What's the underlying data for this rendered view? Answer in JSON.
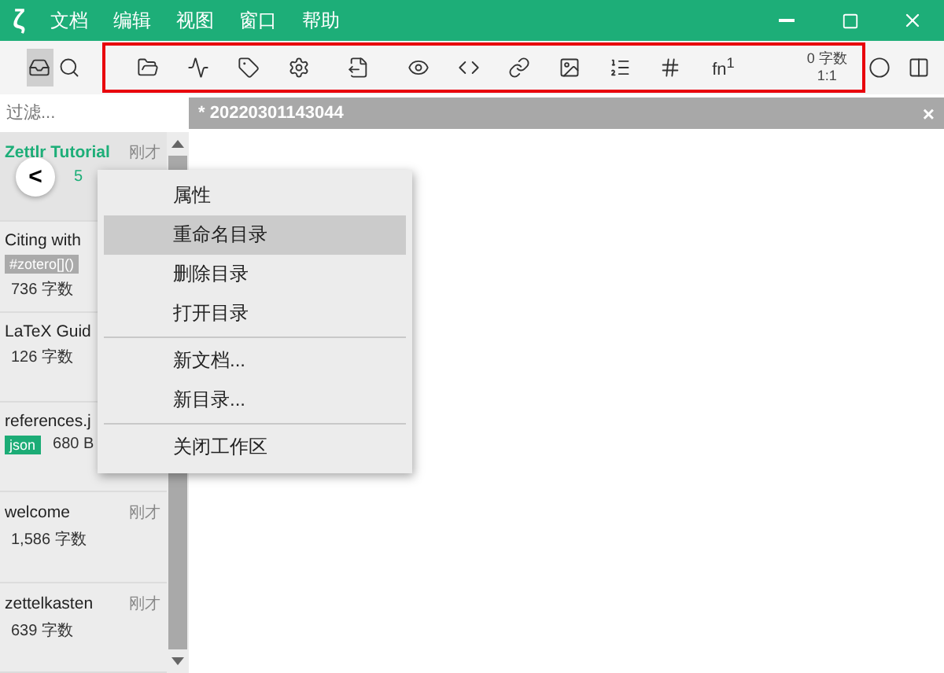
{
  "window": {
    "logo": "ζ",
    "menu": [
      "文档",
      "编辑",
      "视图",
      "窗口",
      "帮助"
    ]
  },
  "toolbar": {
    "left": [
      {
        "kind": "drawer",
        "selected": true
      },
      {
        "kind": "search",
        "selected": false
      }
    ],
    "tools": [
      {
        "kind": "folder"
      },
      {
        "kind": "chart"
      },
      {
        "kind": "tag"
      },
      {
        "kind": "settings"
      },
      {
        "kind": "export"
      },
      {
        "kind": "eye"
      },
      {
        "kind": "code"
      },
      {
        "kind": "link"
      },
      {
        "kind": "image"
      },
      {
        "kind": "list"
      },
      {
        "kind": "table"
      }
    ],
    "footnote": "fn$^{1}$",
    "word_count": "0 字数",
    "ratio": "1:1",
    "highlighted": true,
    "right": [
      {
        "kind": "circle"
      },
      {
        "kind": "columns"
      }
    ]
  },
  "sidebar": {
    "filter_placeholder": "过滤...",
    "back": "<",
    "items": [
      {
        "title": "Zettlr Tutorial",
        "kind": "directory",
        "time": "刚才",
        "meta": "5",
        "selected": true
      },
      {
        "title": "Citing with",
        "kind": "file",
        "meta": "736 字数",
        "tags": [
          {
            "label": "#zotero[]()",
            "color": "#aaaaaa"
          }
        ],
        "selected": false
      },
      {
        "title": "LaTeX Guid",
        "kind": "file",
        "meta": "126 字数",
        "selected": false
      },
      {
        "title": "references.j",
        "kind": "file",
        "meta": "680 B",
        "tags": [
          {
            "label": "json",
            "color": "#1cac76"
          }
        ],
        "selected": false
      },
      {
        "title": "welcome",
        "kind": "file",
        "time": "刚才",
        "meta": "1,586 字数",
        "selected": false
      },
      {
        "title": "zettelkasten",
        "kind": "file",
        "time": "刚才",
        "meta": "639 字数",
        "selected": false
      }
    ]
  },
  "tab": {
    "title": "* 20220301143044",
    "close": "×"
  },
  "context_menu": [
    {
      "kind": "item",
      "label": "属性",
      "selected": false
    },
    {
      "kind": "item",
      "label": "重命名目录",
      "selected": true
    },
    {
      "kind": "item",
      "label": "删除目录",
      "selected": false
    },
    {
      "kind": "item",
      "label": "打开目录",
      "selected": false
    },
    {
      "kind": "divider"
    },
    {
      "kind": "item",
      "label": "新文档...",
      "selected": false
    },
    {
      "kind": "item",
      "label": "新目录...",
      "selected": false
    },
    {
      "kind": "divider"
    },
    {
      "kind": "item",
      "label": "关闭工作区",
      "selected": false
    }
  ]
}
